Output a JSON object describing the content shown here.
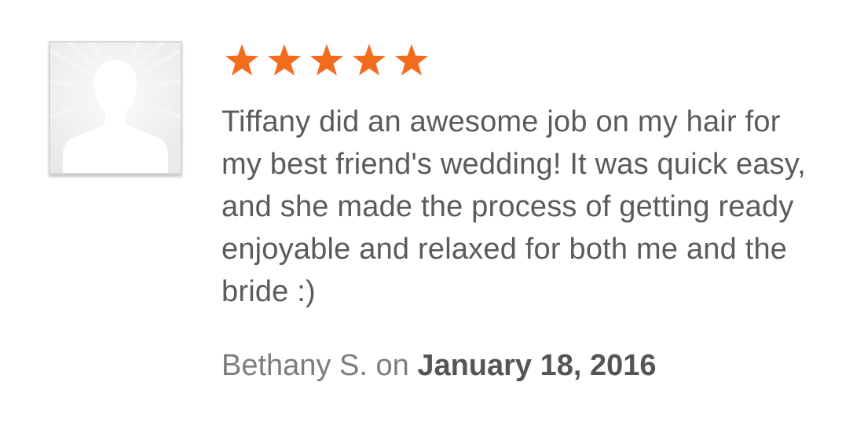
{
  "review": {
    "rating": 5,
    "rating_max": 5,
    "star_color": "#f26c1d",
    "text": "Tiffany did an awesome job on my hair for my best friend's wedding! It was quick easy, and she made the process of getting ready enjoyable and relaxed for both me and the bride :)",
    "author": "Bethany S.",
    "on_word": "on",
    "date": "January 18, 2016"
  },
  "avatar": {
    "icon": "default-user-silhouette-icon"
  }
}
